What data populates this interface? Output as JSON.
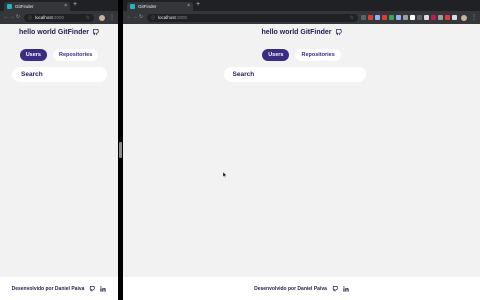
{
  "browser": {
    "tab_title": "GitFinder",
    "close_glyph": "×",
    "new_tab_glyph": "+",
    "url_host": "localhost",
    "url_port": ":3000",
    "extension_colors": [
      "#5f6368",
      "#e53935",
      "#8ab4f8",
      "#e53935",
      "#34a853",
      "#8ab4f8",
      "#9e9e9e",
      "#ffffff",
      "#5f6368",
      "#dadce0",
      "#c2185b",
      "#9e9e9e",
      "#e53935",
      "#dadce0"
    ]
  },
  "app": {
    "brand": "hello world GitFinder",
    "tabs": [
      {
        "label": "Users",
        "active": true
      },
      {
        "label": "Repositories",
        "active": false
      }
    ],
    "search_placeholder": "Search",
    "footer_credit": "Desenvolvido por Daniel Paiva"
  },
  "colors": {
    "brand_purple": "#3a2c84",
    "text_dark": "#241c4f",
    "page_bg": "#f2f2f2"
  }
}
